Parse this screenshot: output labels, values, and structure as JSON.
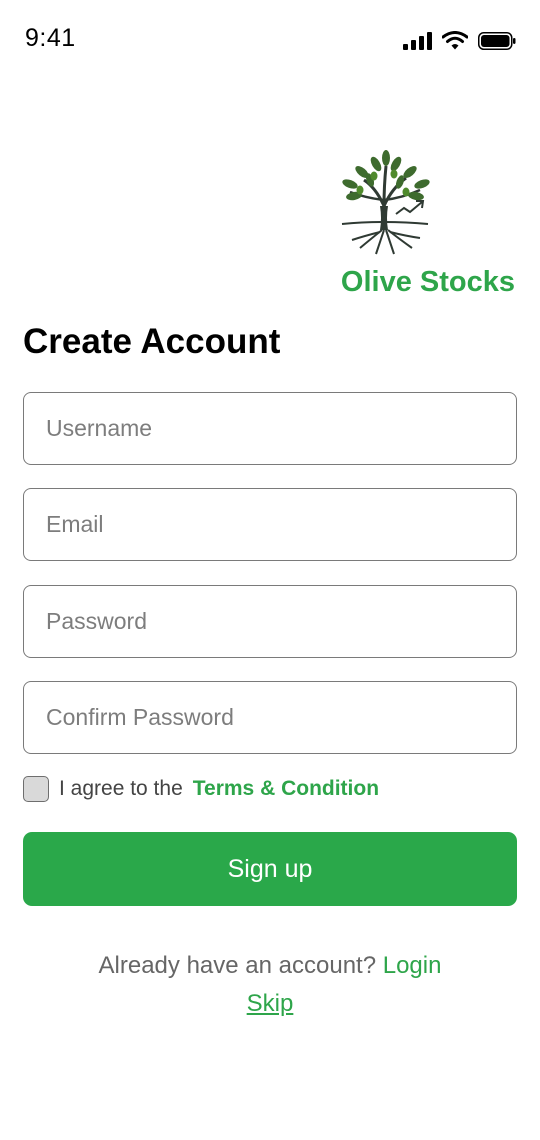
{
  "status_bar": {
    "time": "9:41",
    "icons": [
      "signal-icon",
      "wifi-icon",
      "battery-icon"
    ]
  },
  "brand": {
    "name": "Olive Stocks",
    "logo_icon": "olive-tree-logo-icon",
    "color": "#2ea54a"
  },
  "form": {
    "title": "Create Account",
    "username_placeholder": "Username",
    "email_placeholder": "Email",
    "password_placeholder": "Password",
    "confirm_password_placeholder": "Confirm Password",
    "terms_prefix": "I agree to the",
    "terms_link": "Terms & Condition",
    "submit_label": "Sign up"
  },
  "footer": {
    "login_prompt": "Already have an account?",
    "login_link": "Login",
    "skip_link": "Skip"
  },
  "colors": {
    "accent": "#2aa84a",
    "text_dark": "#000000",
    "placeholder": "#7d7d7d"
  }
}
